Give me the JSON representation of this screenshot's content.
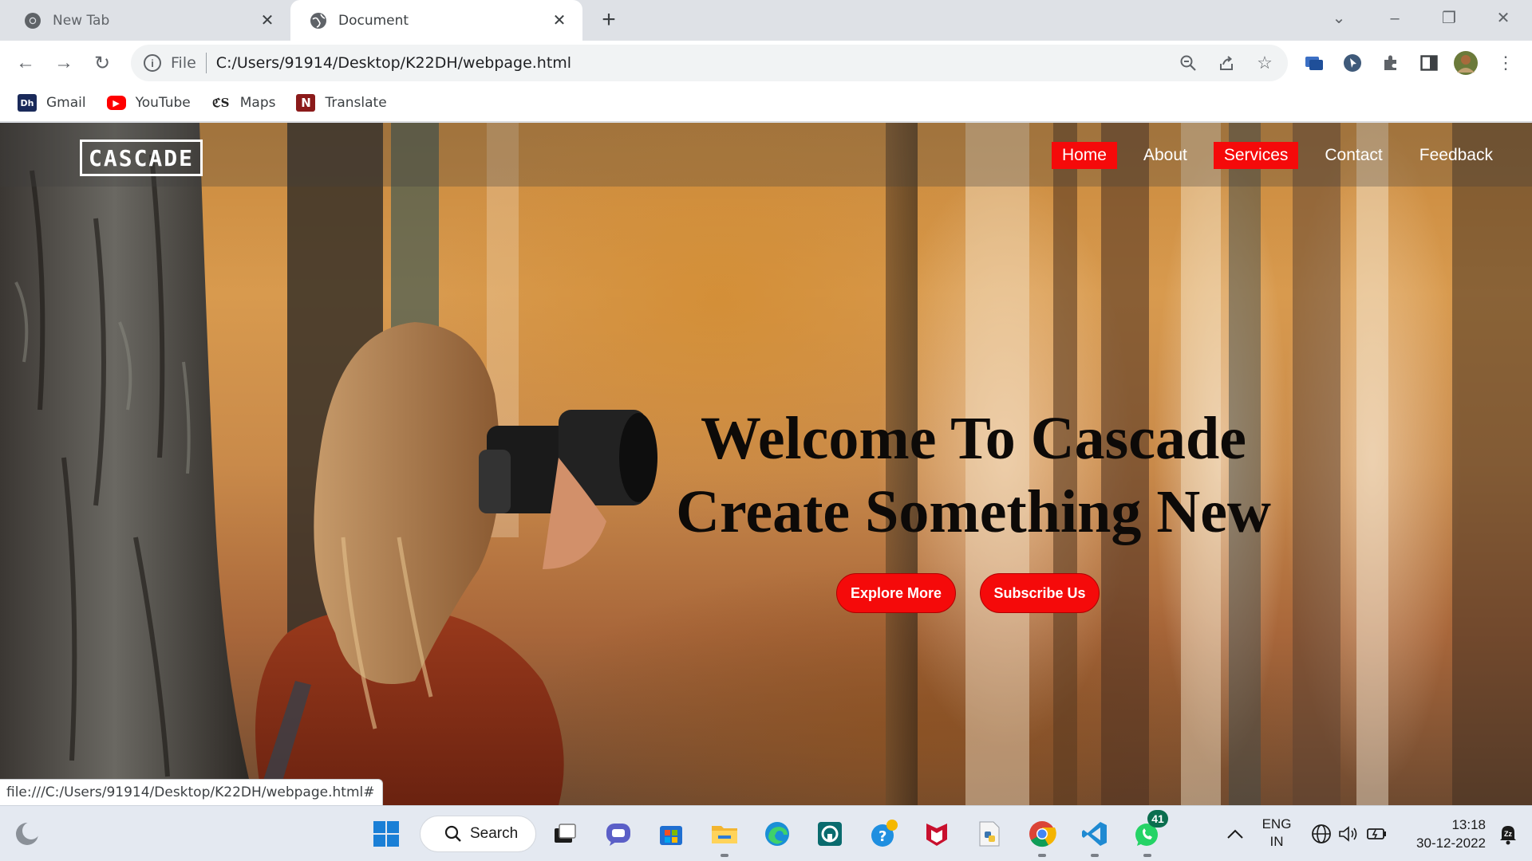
{
  "browser": {
    "tabs": [
      {
        "title": "New Tab",
        "active": false
      },
      {
        "title": "Document",
        "active": true
      }
    ],
    "new_tab_symbol": "+",
    "address": {
      "scheme_label": "File",
      "url": "C:/Users/91914/Desktop/K22DH/webpage.html"
    },
    "bookmarks": [
      {
        "label": "Gmail",
        "icon": "dh-icon",
        "color": "#1a2a5a"
      },
      {
        "label": "YouTube",
        "icon": "youtube-icon",
        "color": "#ff0000"
      },
      {
        "label": "Maps",
        "icon": "ts-icon",
        "color": "#222222"
      },
      {
        "label": "Translate",
        "icon": "n-icon",
        "color": "#8b1a1a"
      }
    ],
    "status_url": "file:///C:/Users/91914/Desktop/K22DH/webpage.html#"
  },
  "site": {
    "logo": "CASCADE",
    "nav": [
      {
        "label": "Home",
        "highlighted": true
      },
      {
        "label": "About",
        "highlighted": false
      },
      {
        "label": "Services",
        "highlighted": true
      },
      {
        "label": "Contact",
        "highlighted": false
      },
      {
        "label": "Feedback",
        "highlighted": false
      }
    ],
    "hero": {
      "line1": "Welcome To Cascade",
      "line2": "Create Something New",
      "buttons": [
        "Explore More",
        "Subscribe Us"
      ]
    },
    "accent_color": "#f50a0a"
  },
  "taskbar": {
    "search_label": "Search",
    "whatsapp_badge": "41",
    "language": "ENG",
    "region": "IN",
    "time": "13:18",
    "date": "30-12-2022"
  }
}
